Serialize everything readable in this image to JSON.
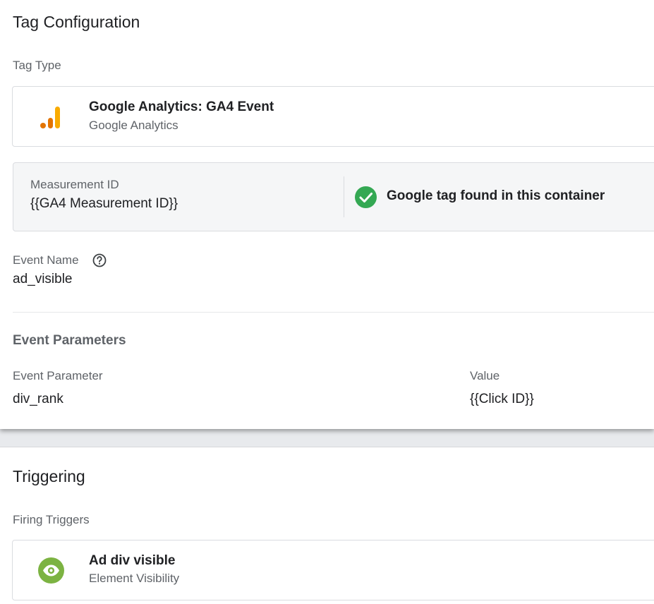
{
  "tag_configuration": {
    "title": "Tag Configuration",
    "tag_type_label": "Tag Type",
    "tag_type": {
      "name": "Google Analytics: GA4 Event",
      "provider": "Google Analytics",
      "icon": "google-analytics-icon",
      "icon_color": "#f9ab00"
    },
    "measurement_id": {
      "label": "Measurement ID",
      "value": "{{GA4 Measurement ID}}"
    },
    "status": {
      "text": "Google tag found in this container",
      "icon": "check-circle-icon",
      "color": "#34a853"
    },
    "event_name": {
      "label": "Event Name",
      "value": "ad_visible",
      "help_icon": "help-icon"
    },
    "event_parameters": {
      "title": "Event Parameters",
      "column_headers": [
        "Event Parameter",
        "Value"
      ],
      "rows": [
        {
          "parameter": "div_rank",
          "value": "{{Click ID}}"
        }
      ]
    }
  },
  "triggering": {
    "title": "Triggering",
    "firing_triggers_label": "Firing Triggers",
    "trigger": {
      "name": "Ad div visible",
      "type": "Element Visibility",
      "icon": "eye-icon",
      "icon_color": "#7cb342"
    }
  }
}
